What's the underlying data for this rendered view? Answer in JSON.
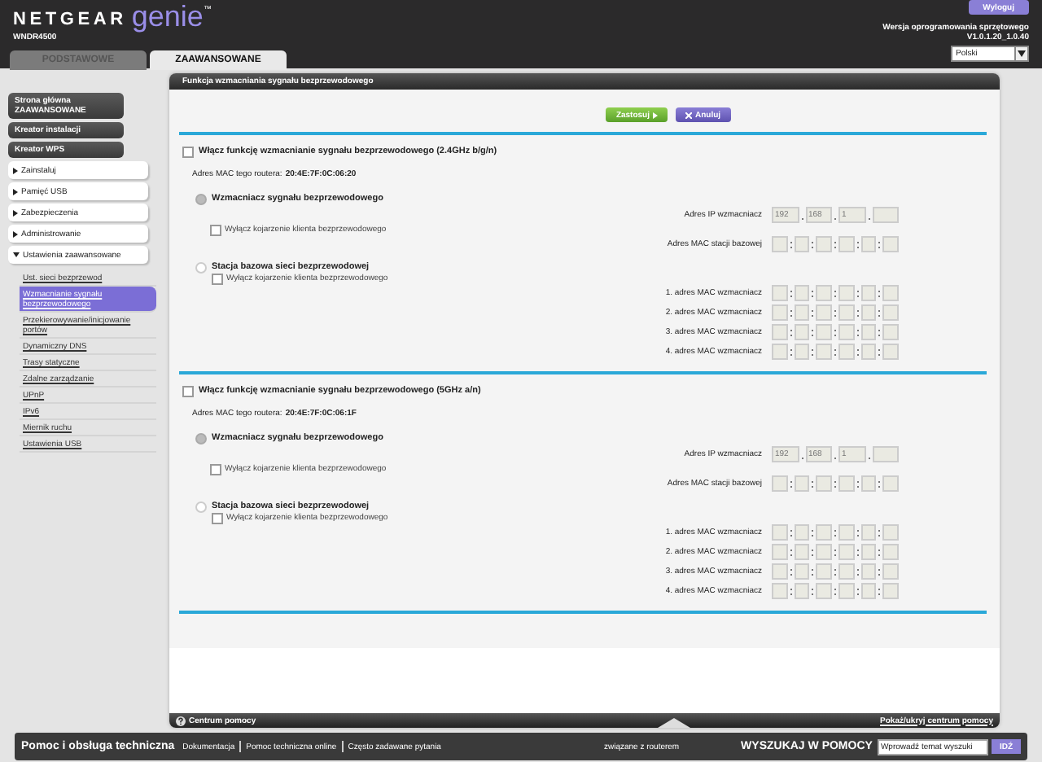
{
  "header": {
    "brand": "NETGEAR",
    "product": "genie",
    "trademark": "™",
    "model": "WNDR4500",
    "logout": "Wyloguj",
    "firmware_label": "Wersja oprogramowania sprzętowego",
    "firmware_version": "V1.0.1.20_1.0.40",
    "language": "Polski"
  },
  "tabs": [
    {
      "label": "PODSTAWOWE",
      "selected": false
    },
    {
      "label": "ZAAWANSOWANE",
      "selected": true
    }
  ],
  "sidebar": {
    "items": [
      {
        "kind": "dark",
        "label": "Strona główna ZAAWANSOWANE"
      },
      {
        "kind": "dark",
        "label": "Kreator instalacji"
      },
      {
        "kind": "dark",
        "label": "Kreator WPS"
      },
      {
        "kind": "group",
        "label": "Zainstaluj",
        "expanded": false
      },
      {
        "kind": "group",
        "label": "Pamięć USB",
        "expanded": false
      },
      {
        "kind": "group",
        "label": "Zabezpieczenia",
        "expanded": false
      },
      {
        "kind": "group",
        "label": "Administrowanie",
        "expanded": false
      },
      {
        "kind": "group",
        "label": "Ustawienia zaawansowane",
        "expanded": true,
        "children": [
          {
            "label": "Ust. sieci bezprzewod",
            "selected": false
          },
          {
            "label": "Wzmacnianie sygnału bezprzewodowego",
            "selected": true
          },
          {
            "label": "Przekierowywanie/inicjowanie portów",
            "selected": false
          },
          {
            "label": "Dynamiczny DNS",
            "selected": false
          },
          {
            "label": "Trasy statyczne",
            "selected": false
          },
          {
            "label": "Zdalne zarządzanie",
            "selected": false
          },
          {
            "label": "UPnP",
            "selected": false
          },
          {
            "label": "IPv6",
            "selected": false
          },
          {
            "label": "Miernik ruchu",
            "selected": false
          },
          {
            "label": "Ustawienia USB",
            "selected": false
          }
        ]
      }
    ]
  },
  "main": {
    "title": "Funkcja wzmacniania sygnału bezprzewodowego",
    "apply": "Zastosuj",
    "cancel": "Anuluj",
    "sections": [
      {
        "enable_label": "Włącz funkcję wzmacnianie sygnału bezprzewodowego (2.4GHz b/g/n)",
        "checked": false,
        "mac_label": "Adres MAC tego routera:",
        "mac_value": "20:4E:7F:0C:06:20",
        "repeater": {
          "label": "Wzmacniacz sygnału bezprzewodowego",
          "selected": true,
          "option": "Wyłącz kojarzenie klienta bezprzewodowego",
          "option_checked": false,
          "ip_label": "Adres IP wzmacniacz",
          "ip": [
            "192",
            "168",
            "1"
          ],
          "base_mac_label": "Adres MAC stacji bazowej"
        },
        "base": {
          "label": "Stacja bazowa sieci bezprzewodowej",
          "selected": false,
          "option": "Wyłącz kojarzenie klienta bezprzewodowego",
          "option_checked": false,
          "mac_labels": [
            "1. adres MAC wzmacniacz",
            "2. adres MAC wzmacniacz",
            "3. adres MAC wzmacniacz",
            "4. adres MAC wzmacniacz"
          ]
        }
      },
      {
        "enable_label": "Włącz funkcję wzmacnianie sygnału bezprzewodowego (5GHz a/n)",
        "checked": false,
        "mac_label": "Adres MAC tego routera:",
        "mac_value": "20:4E:7F:0C:06:1F",
        "repeater": {
          "label": "Wzmacniacz sygnału bezprzewodowego",
          "selected": true,
          "option": "Wyłącz kojarzenie klienta bezprzewodowego",
          "option_checked": false,
          "ip_label": "Adres IP wzmacniacz",
          "ip": [
            "192",
            "168",
            "1"
          ],
          "base_mac_label": "Adres MAC stacji bazowej"
        },
        "base": {
          "label": "Stacja bazowa sieci bezprzewodowej",
          "selected": false,
          "option": "Wyłącz kojarzenie klienta bezprzewodowego",
          "option_checked": false,
          "mac_labels": [
            "1. adres MAC wzmacniacz",
            "2. adres MAC wzmacniacz",
            "3. adres MAC wzmacniacz",
            "4. adres MAC wzmacniacz"
          ]
        }
      }
    ]
  },
  "help_bar": {
    "label": "Centrum pomocy",
    "toggle": "Pokaż/ukryj centrum pomocy"
  },
  "footer": {
    "title": "Pomoc i obsługa techniczna",
    "links": [
      "Dokumentacja",
      "Pomoc techniczna online",
      "Często zadawane pytania"
    ],
    "note": "związane z routerem",
    "search_label": "WYSZUKAJ W POMOCY",
    "search_placeholder": "Wprowadź temat wyszuki",
    "search_button": "IDŹ"
  }
}
